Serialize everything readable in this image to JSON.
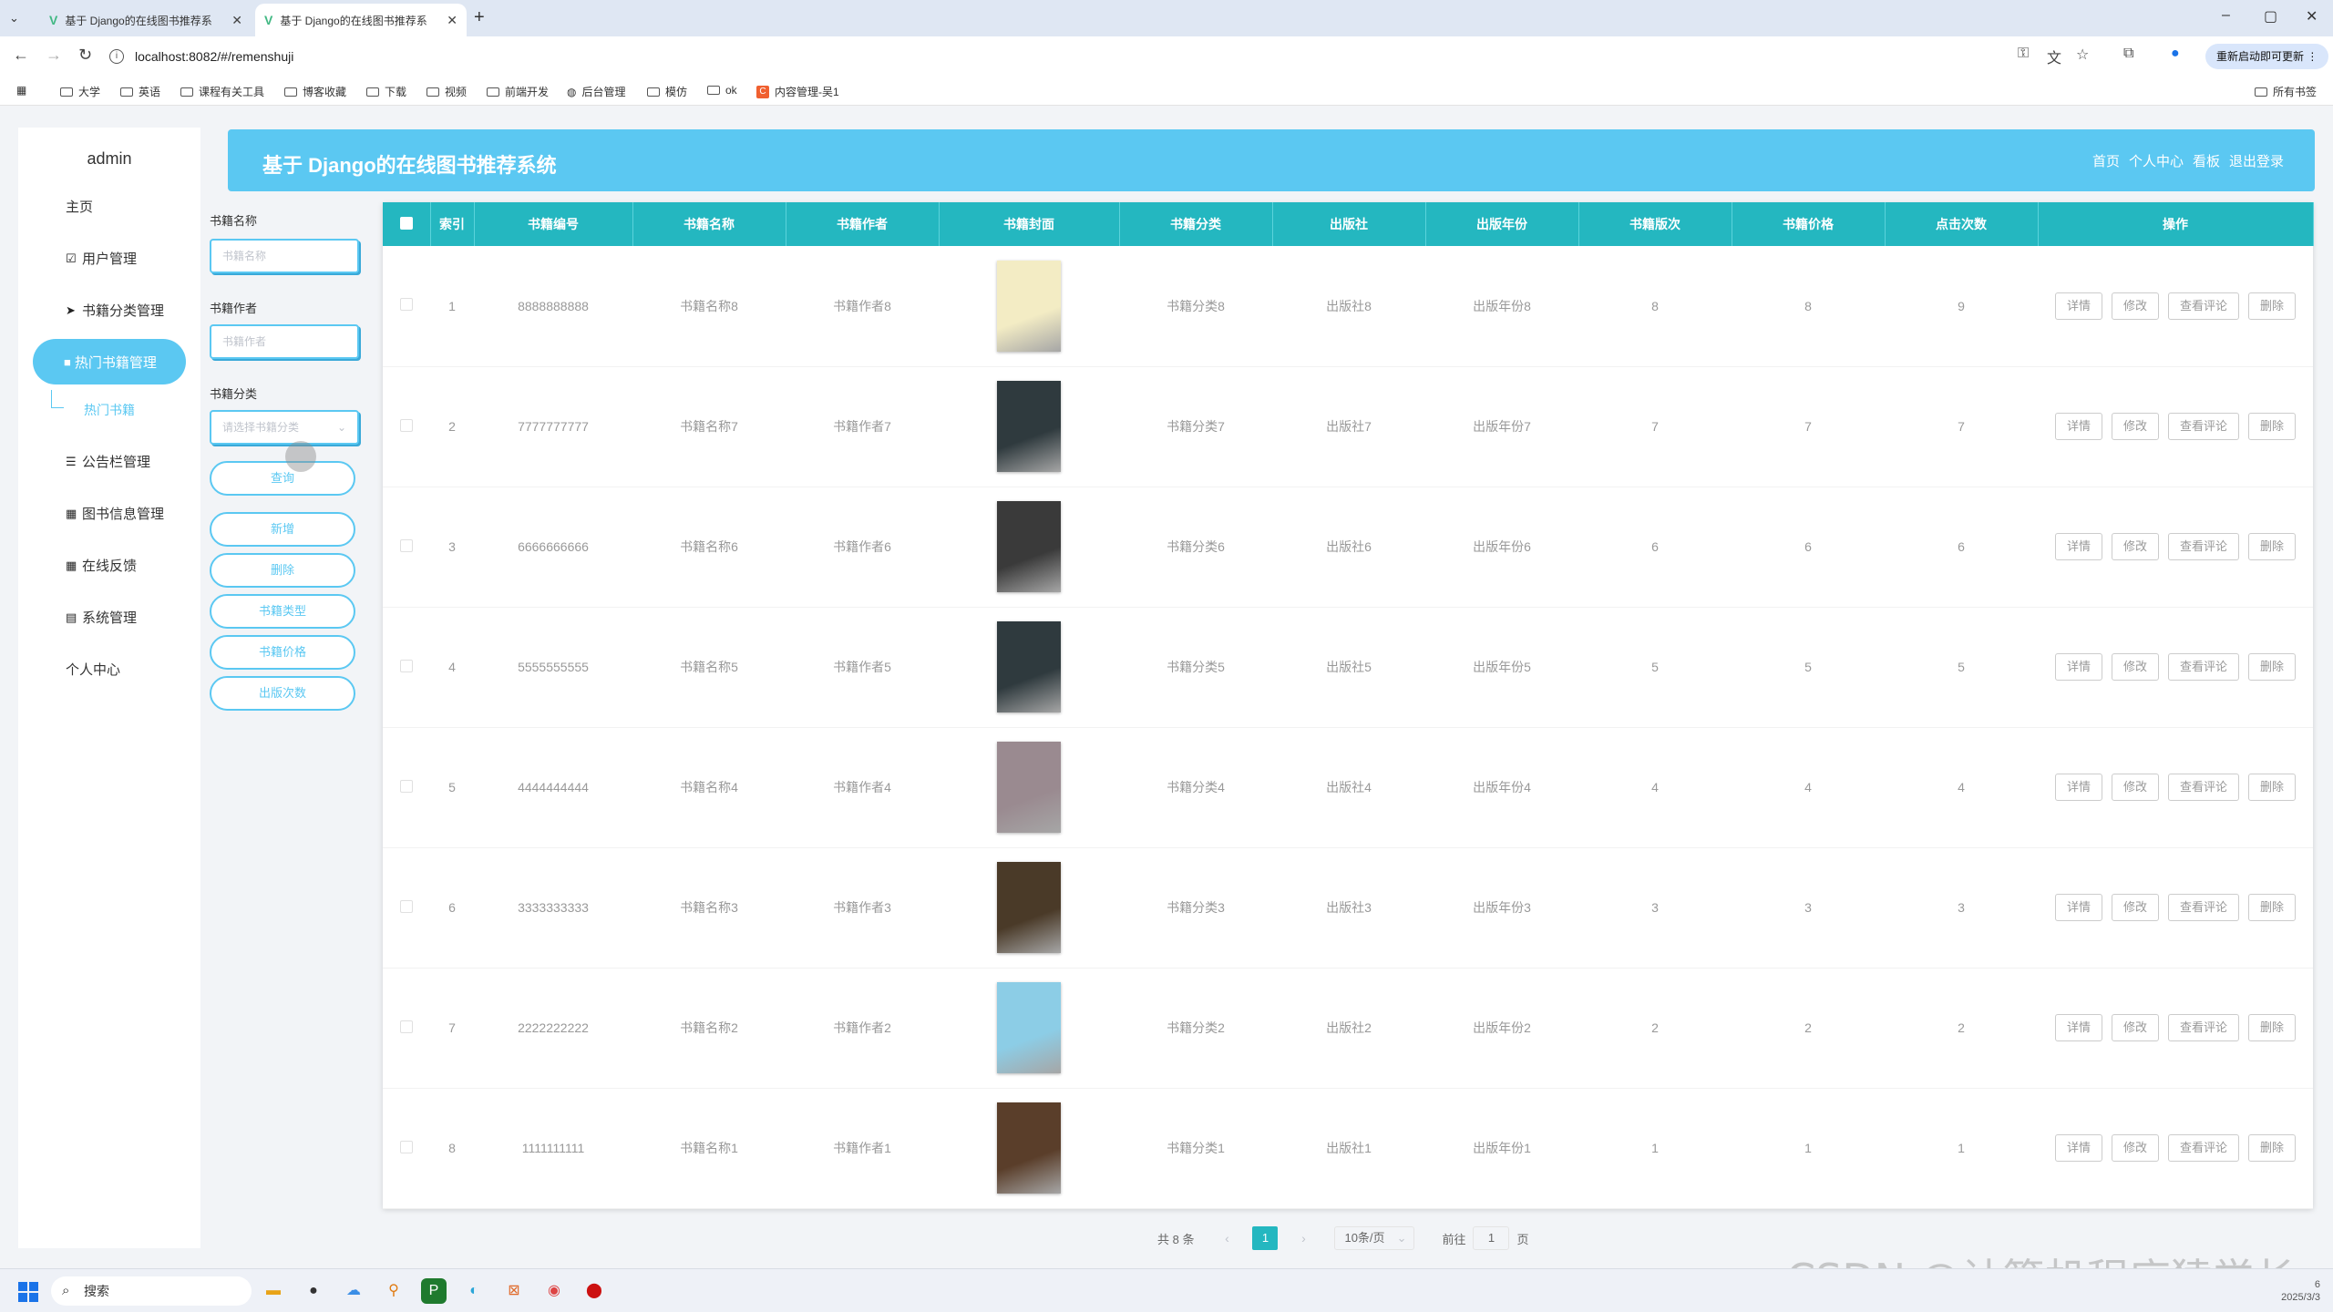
{
  "browser": {
    "tabs": [
      {
        "title": "基于 Django的在线图书推荐系",
        "active": false
      },
      {
        "title": "基于 Django的在线图书推荐系",
        "active": true
      }
    ],
    "new_tab": "+",
    "window_controls": [
      "–",
      "▢",
      "✕"
    ],
    "url": "localhost:8082/#/remenshuji",
    "update_button": "重新启动即可更新",
    "bookmarks": [
      "大学",
      "英语",
      "课程有关工具",
      "博客收藏",
      "下载",
      "视频",
      "前端开发",
      "后台管理",
      "模仿",
      "ok",
      "内容管理-吴1"
    ],
    "all_bookmarks": "所有书签"
  },
  "sidebar": {
    "user": "admin",
    "items": [
      {
        "label": "主页",
        "icon": ""
      },
      {
        "label": "用户管理",
        "icon": "edit-icon"
      },
      {
        "label": "书籍分类管理",
        "icon": "send-icon"
      },
      {
        "label": "热门书籍管理",
        "icon": "briefcase-icon",
        "active": true
      },
      {
        "label": "公告栏管理",
        "icon": "sliders-icon"
      },
      {
        "label": "图书信息管理",
        "icon": "grid-icon"
      },
      {
        "label": "在线反馈",
        "icon": "grid-icon"
      },
      {
        "label": "系统管理",
        "icon": "doc-icon"
      },
      {
        "label": "个人中心",
        "icon": ""
      }
    ],
    "submenu": "热门书籍"
  },
  "header": {
    "title": "基于 Django的在线图书推荐系统",
    "links": [
      "首页",
      "个人中心",
      "看板",
      "退出登录"
    ]
  },
  "search": {
    "name_label": "书籍名称",
    "name_placeholder": "书籍名称",
    "author_label": "书籍作者",
    "author_placeholder": "书籍作者",
    "category_label": "书籍分类",
    "category_placeholder": "请选择书籍分类",
    "buttons": [
      "查询",
      "新增",
      "删除",
      "书籍类型",
      "书籍价格",
      "出版次数"
    ]
  },
  "table": {
    "headers": [
      "索引",
      "书籍编号",
      "书籍名称",
      "书籍作者",
      "书籍封面",
      "书籍分类",
      "出版社",
      "出版年份",
      "书籍版次",
      "书籍价格",
      "点击次数",
      "操作"
    ],
    "actions": [
      "详情",
      "修改",
      "查看评论",
      "删除"
    ],
    "rows": [
      {
        "index": "1",
        "code": "8888888888",
        "name": "书籍名称8",
        "author": "书籍作者8",
        "category": "书籍分类8",
        "publisher": "出版社8",
        "year": "出版年份8",
        "edition": "8",
        "price": "8",
        "clicks": "9",
        "cover_color": "#f3ecc4"
      },
      {
        "index": "2",
        "code": "7777777777",
        "name": "书籍名称7",
        "author": "书籍作者7",
        "category": "书籍分类7",
        "publisher": "出版社7",
        "year": "出版年份7",
        "edition": "7",
        "price": "7",
        "clicks": "7",
        "cover_color": "#2f3a3e"
      },
      {
        "index": "3",
        "code": "6666666666",
        "name": "书籍名称6",
        "author": "书籍作者6",
        "category": "书籍分类6",
        "publisher": "出版社6",
        "year": "出版年份6",
        "edition": "6",
        "price": "6",
        "clicks": "6",
        "cover_color": "#3a3a3a"
      },
      {
        "index": "4",
        "code": "5555555555",
        "name": "书籍名称5",
        "author": "书籍作者5",
        "category": "书籍分类5",
        "publisher": "出版社5",
        "year": "出版年份5",
        "edition": "5",
        "price": "5",
        "clicks": "5",
        "cover_color": "#2f3a3e"
      },
      {
        "index": "5",
        "code": "4444444444",
        "name": "书籍名称4",
        "author": "书籍作者4",
        "category": "书籍分类4",
        "publisher": "出版社4",
        "year": "出版年份4",
        "edition": "4",
        "price": "4",
        "clicks": "4",
        "cover_color": "#9a8a90"
      },
      {
        "index": "6",
        "code": "3333333333",
        "name": "书籍名称3",
        "author": "书籍作者3",
        "category": "书籍分类3",
        "publisher": "出版社3",
        "year": "出版年份3",
        "edition": "3",
        "price": "3",
        "clicks": "3",
        "cover_color": "#4a3a28"
      },
      {
        "index": "7",
        "code": "2222222222",
        "name": "书籍名称2",
        "author": "书籍作者2",
        "category": "书籍分类2",
        "publisher": "出版社2",
        "year": "出版年份2",
        "edition": "2",
        "price": "2",
        "clicks": "2",
        "cover_color": "#8ccde6"
      },
      {
        "index": "8",
        "code": "1111111111",
        "name": "书籍名称1",
        "author": "书籍作者1",
        "category": "书籍分类1",
        "publisher": "出版社1",
        "year": "出版年份1",
        "edition": "1",
        "price": "1",
        "clicks": "1",
        "cover_color": "#5a3e2a"
      }
    ]
  },
  "pagination": {
    "total": "共 8 条",
    "current_page": "1",
    "page_size": "10条/页",
    "goto_label": "前往",
    "goto_value": "1",
    "page_suffix": "页"
  },
  "taskbar": {
    "search": "搜索",
    "date": "2025/3/3",
    "time": "6"
  },
  "watermark": "CSDN @计算机程序猿学长",
  "colors": {
    "accent": "#5bc8f2",
    "table_header": "#24b7c0"
  }
}
